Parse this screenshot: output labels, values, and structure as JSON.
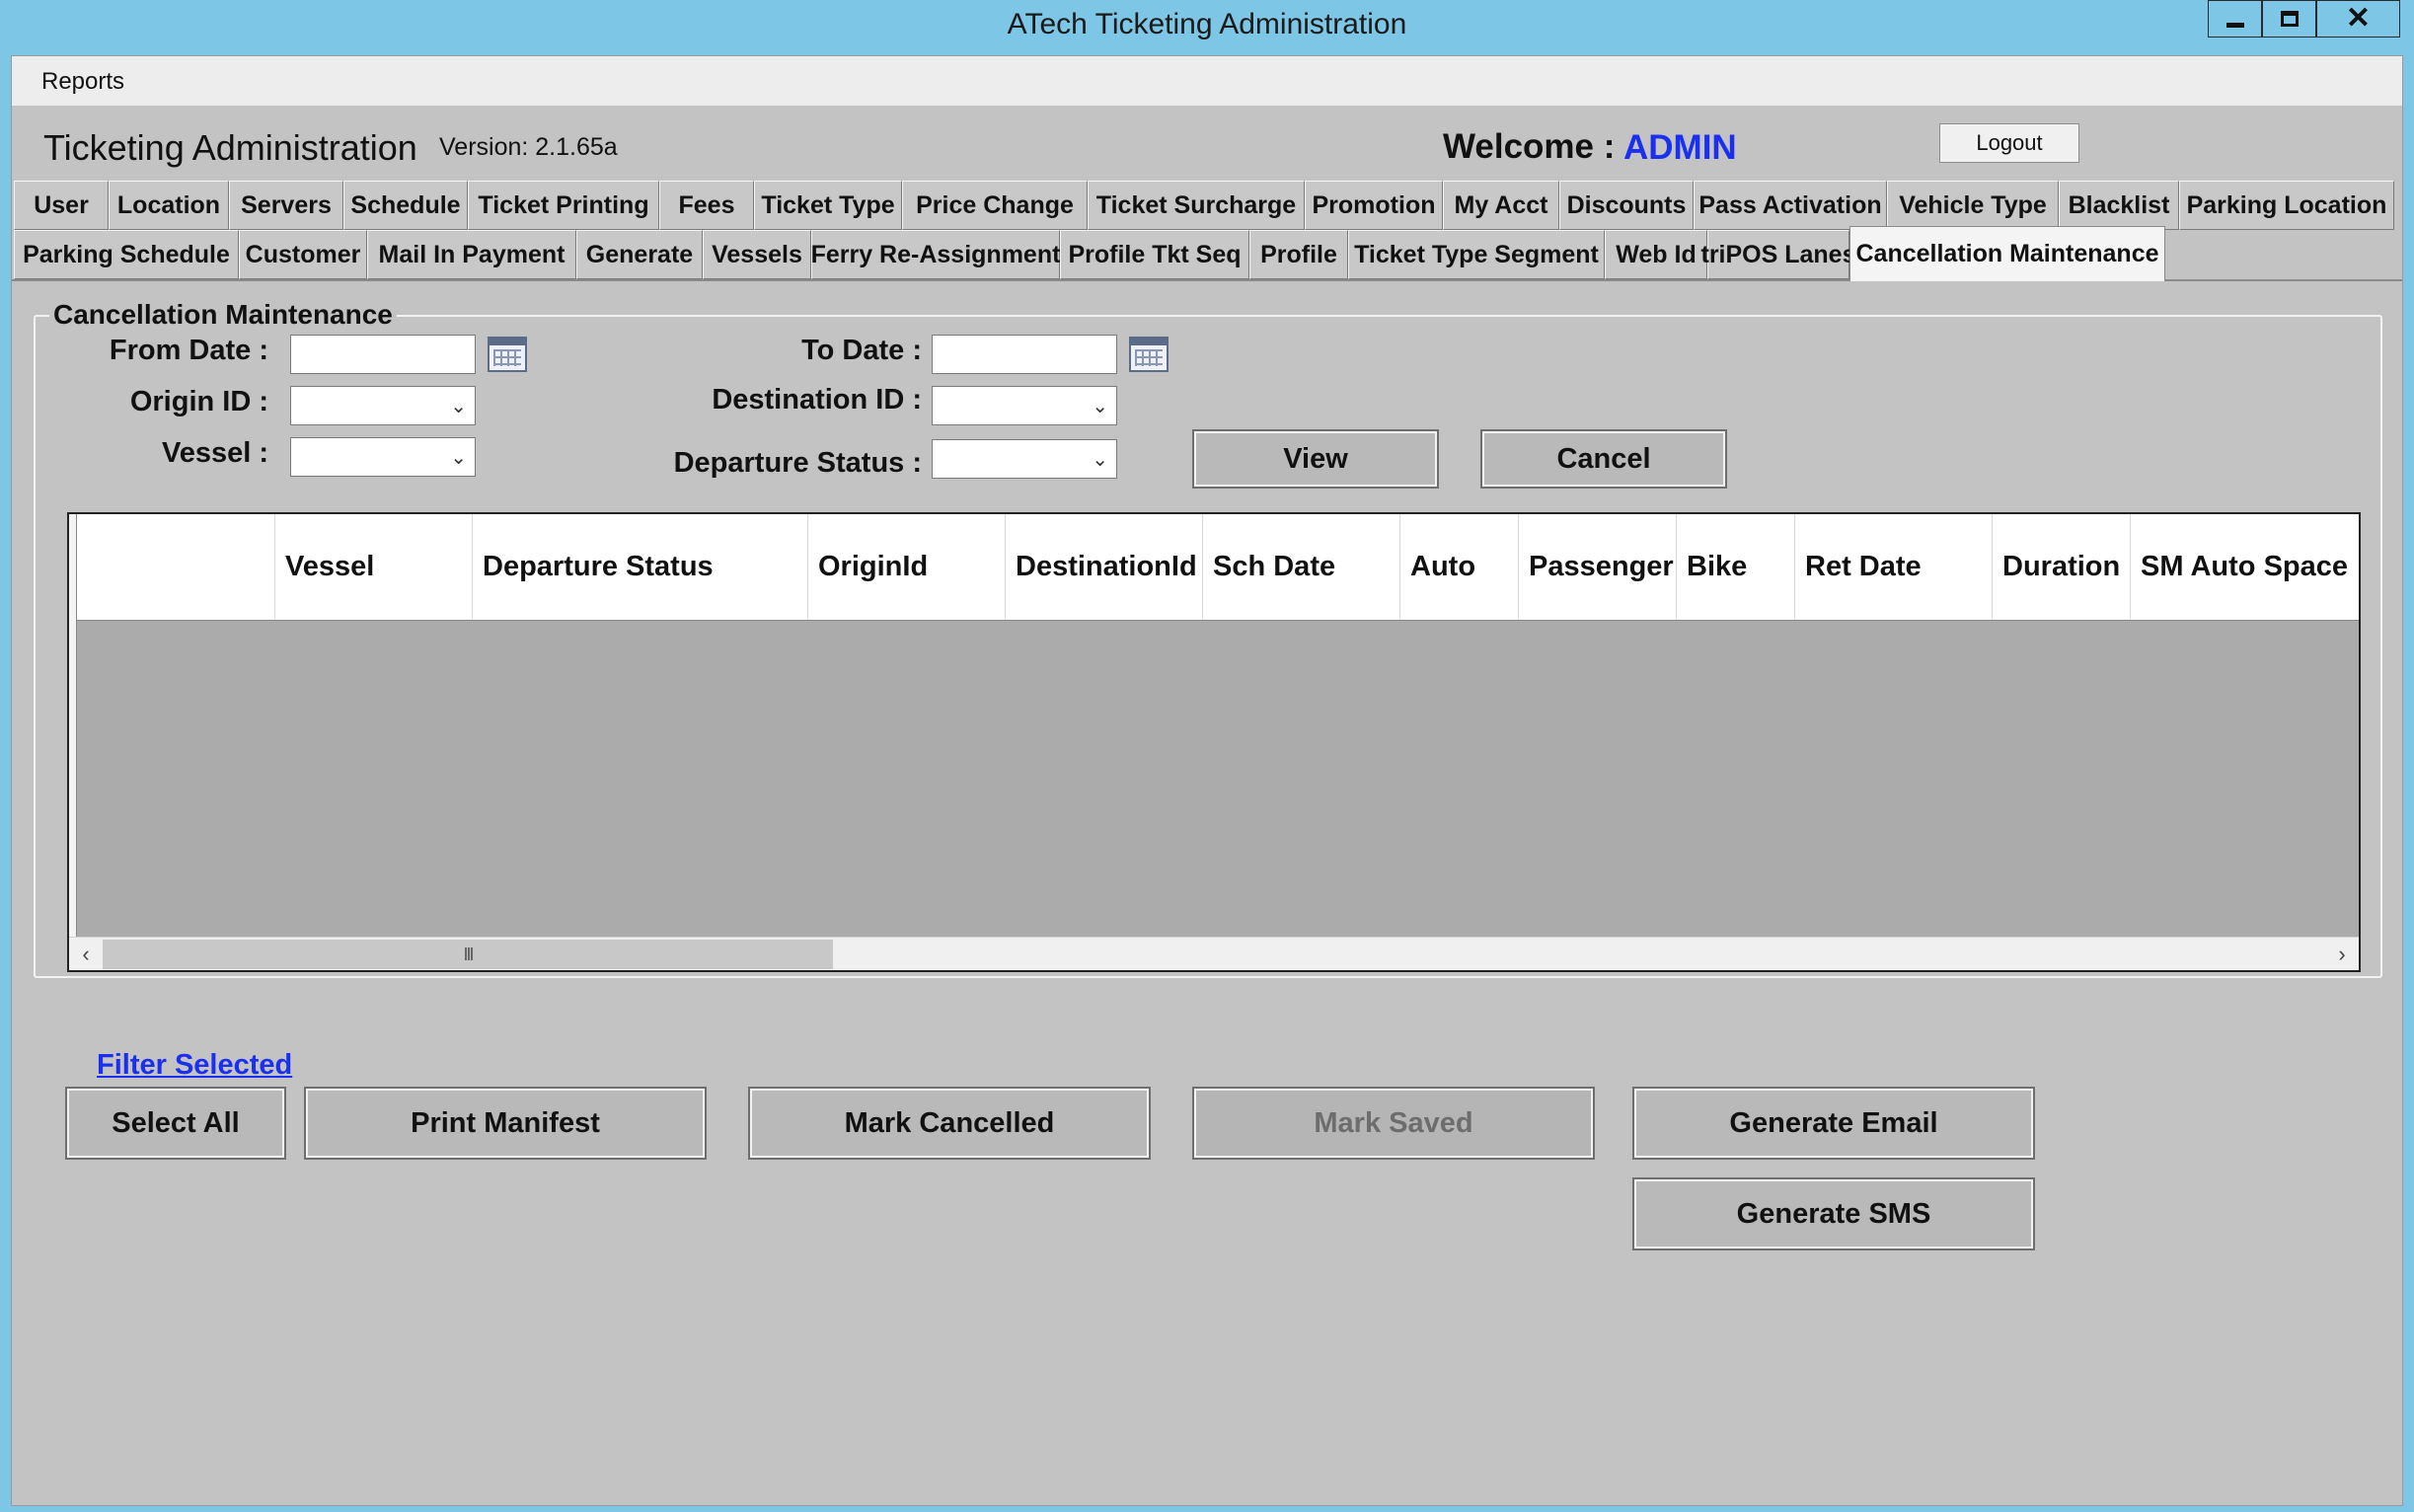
{
  "window": {
    "title": "ATech Ticketing Administration"
  },
  "menu": {
    "reports": "Reports"
  },
  "header": {
    "app_title": "Ticketing Administration",
    "version": "Version: 2.1.65a",
    "welcome": "Welcome :",
    "user": "ADMIN",
    "logout": "Logout"
  },
  "tabs_row1": [
    "User",
    "Location",
    "Servers",
    "Schedule",
    "Ticket Printing",
    "Fees",
    "Ticket Type",
    "Price Change",
    "Ticket Surcharge",
    "Promotion",
    "My Acct",
    "Discounts",
    "Pass Activation",
    "Vehicle Type",
    "Blacklist",
    "Parking Location"
  ],
  "tabs_row2": [
    "Parking Schedule",
    "Customer",
    "Mail In Payment",
    "Generate",
    "Vessels",
    "Ferry Re-Assignment",
    "Profile Tkt Seq",
    "Profile",
    "Ticket Type Segment",
    "Web Id",
    "triPOS Lanes",
    "Cancellation Maintenance"
  ],
  "active_tab": "Cancellation Maintenance",
  "form": {
    "group_title": "Cancellation Maintenance",
    "from_date_label": "From Date :",
    "to_date_label": "To Date :",
    "origin_label": "Origin ID :",
    "destination_label": "Destination ID :",
    "vessel_label": "Vessel :",
    "departure_status_label": "Departure Status :",
    "from_date_value": "",
    "to_date_value": "",
    "view_button": "View",
    "cancel_button": "Cancel"
  },
  "grid": {
    "columns": [
      "",
      "Vessel",
      "Departure Status",
      "OriginId",
      "DestinationId",
      "Sch Date",
      "Auto",
      "Passenger",
      "Bike",
      "Ret Date",
      "Duration",
      "SM Auto Space"
    ],
    "rows": [],
    "scroll_grip": "III"
  },
  "links": {
    "filter_selected": "Filter Selected"
  },
  "actions": {
    "select_all": "Select All",
    "print_manifest": "Print Manifest",
    "mark_cancelled": "Mark Cancelled",
    "mark_saved": "Mark Saved",
    "generate_email": "Generate Email",
    "generate_sms": "Generate SMS"
  },
  "colors": {
    "titlebar": "#7ec6e6",
    "window_bg": "#c3c3c3",
    "link": "#1b2ff0",
    "grid_bg": "#ababab"
  }
}
